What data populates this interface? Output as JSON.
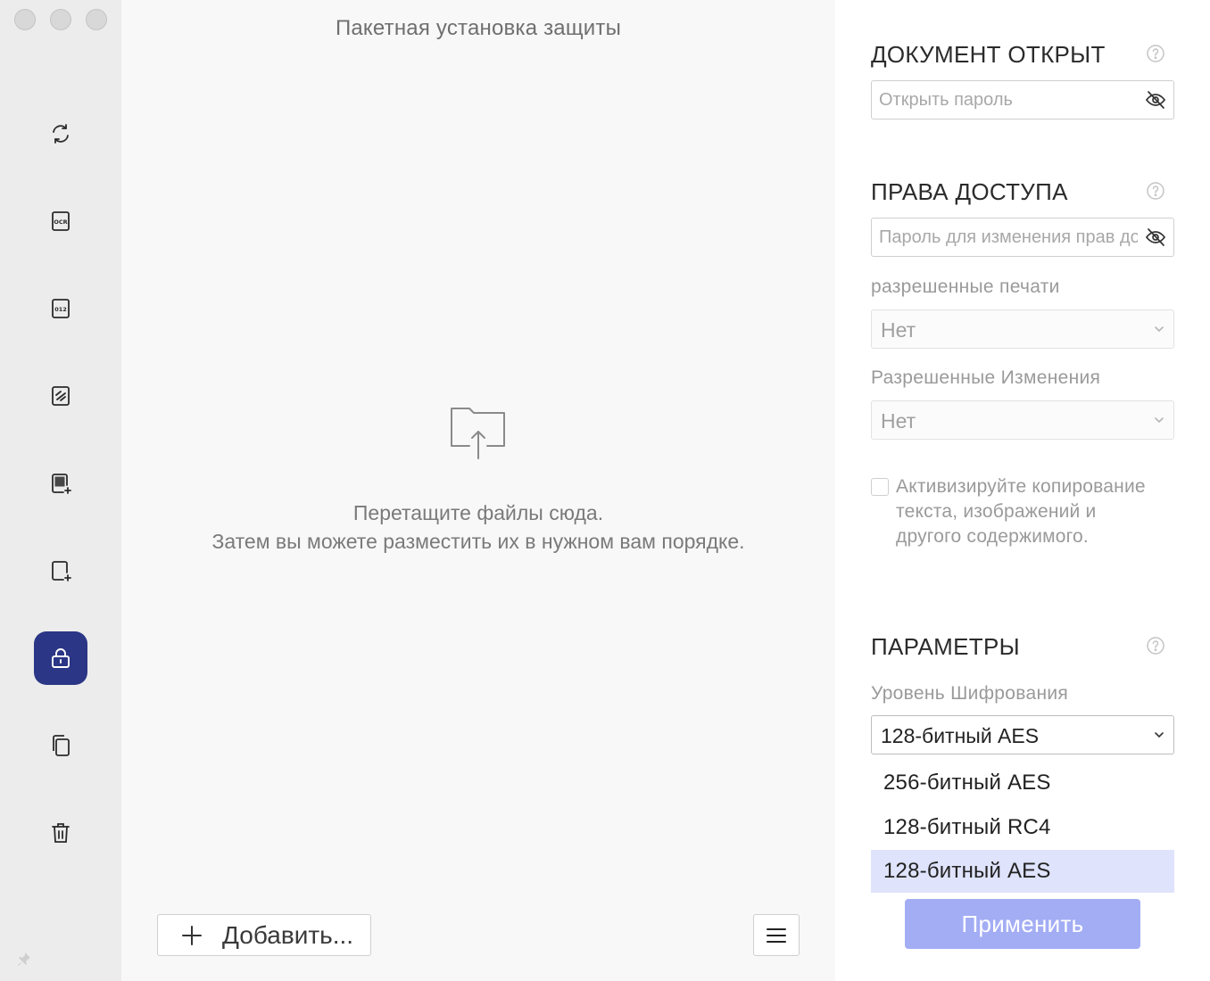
{
  "window": {
    "title": "Пакетная установка защиты"
  },
  "sidebar": {
    "items": [
      {
        "icon": "convert-icon",
        "active": false
      },
      {
        "icon": "ocr-icon",
        "active": false
      },
      {
        "icon": "bates-number-icon",
        "active": false
      },
      {
        "icon": "compress-icon",
        "active": false
      },
      {
        "icon": "add-watermark-icon",
        "active": false
      },
      {
        "icon": "add-background-icon",
        "active": false
      },
      {
        "icon": "security-lock-icon",
        "active": true
      },
      {
        "icon": "copy-icon",
        "active": false
      },
      {
        "icon": "trash-icon",
        "active": false
      }
    ],
    "accent_color": "#2b3686"
  },
  "dropzone": {
    "line1": "Перетащите файлы сюда.",
    "line2": "Затем вы можете разместить их в нужном вам порядке."
  },
  "footer": {
    "add_label": "Добавить..."
  },
  "open_password": {
    "title": "ДОКУМЕНТ ОТКРЫТ",
    "placeholder": "Открыть пароль",
    "value": ""
  },
  "permissions": {
    "title": "ПРАВА ДОСТУПА",
    "placeholder": "Пароль для изменения прав доступа",
    "value": "",
    "print_label": "разрешенные печати",
    "print_value": "Нет",
    "changes_label": "Разрешенные Изменения",
    "changes_value": "Нет",
    "copy_checkbox_label": "Активизируйте копирование текста, изображений и другого содержимого.",
    "copy_checked": false
  },
  "options": {
    "title": "ПАРАМЕТРЫ",
    "encryption_label": "Уровень Шифрования",
    "encryption_value": "128-битный AES",
    "encryption_options": [
      "256-битный AES",
      "128-битный RC4",
      "128-битный AES"
    ],
    "selected_option": "128-битный AES"
  },
  "apply_label": "Применить",
  "colors": {
    "apply_button": "#a3adf4",
    "selected_option_bg": "#dfe3fb"
  }
}
